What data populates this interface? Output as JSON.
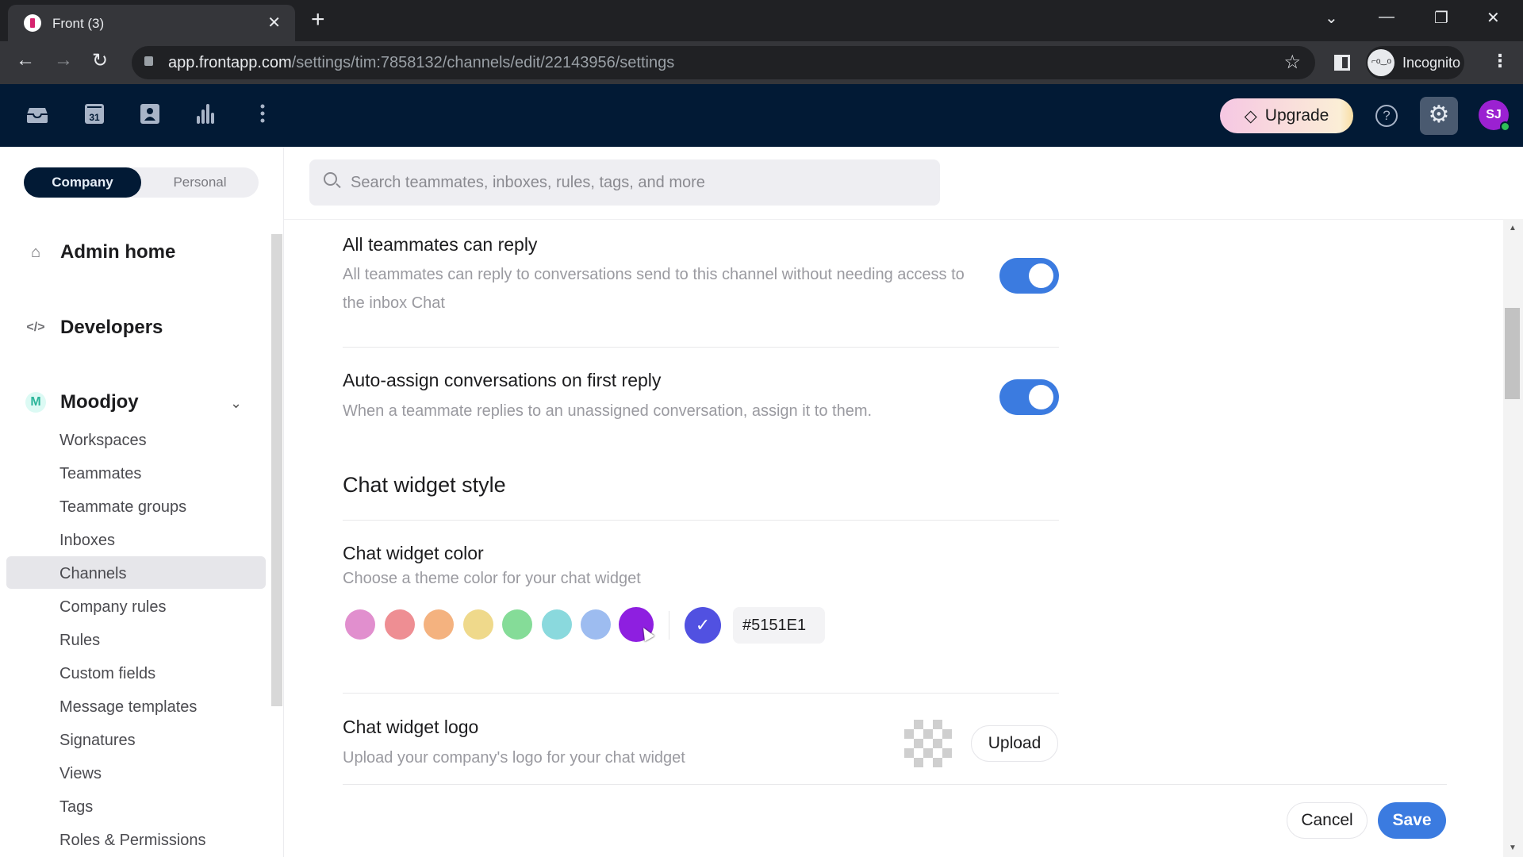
{
  "browser": {
    "tab_title": "Front (3)",
    "url_host": "app.frontapp.com",
    "url_path": "/settings/tim:7858132/channels/edit/22143956/settings",
    "profile_label": "Incognito"
  },
  "appbar": {
    "icons": [
      "inbox-icon",
      "calendar-icon",
      "contacts-icon",
      "analytics-icon",
      "more-icon"
    ],
    "calendar_day": "31",
    "upgrade_label": "Upgrade",
    "help_glyph": "?",
    "avatar_initials": "SJ",
    "avatar_color": "#9b21d1",
    "status": "online"
  },
  "sidebar": {
    "scope_tabs": [
      {
        "label": "Company",
        "active": true
      },
      {
        "label": "Personal",
        "active": false
      }
    ],
    "admin_home": "Admin home",
    "developers": "Developers",
    "workspace": {
      "badge": "M",
      "name": "Moodjoy",
      "expanded": true
    },
    "items": [
      {
        "label": "Workspaces"
      },
      {
        "label": "Teammates"
      },
      {
        "label": "Teammate groups"
      },
      {
        "label": "Inboxes"
      },
      {
        "label": "Channels",
        "active": true
      },
      {
        "label": "Company rules"
      },
      {
        "label": "Rules"
      },
      {
        "label": "Custom fields"
      },
      {
        "label": "Message templates"
      },
      {
        "label": "Signatures"
      },
      {
        "label": "Views"
      },
      {
        "label": "Tags"
      },
      {
        "label": "Roles & Permissions"
      }
    ]
  },
  "search": {
    "placeholder": "Search teammates, inboxes, rules, tags, and more"
  },
  "settings": {
    "all_teammates_reply": {
      "title": "All teammates can reply",
      "description": "All teammates can reply to conversations send to this channel without needing access to the inbox Chat",
      "enabled": true
    },
    "auto_assign": {
      "title": "Auto-assign conversations on first reply",
      "description": "When a teammate replies to an unassigned conversation, assign it to them.",
      "enabled": true
    },
    "chat_widget_style": {
      "heading": "Chat widget style",
      "color": {
        "title": "Chat widget color",
        "description": "Choose a theme color for your chat widget",
        "swatches": [
          "#e18fce",
          "#ee8e93",
          "#f4b27f",
          "#efd98b",
          "#85dc98",
          "#8ad9dd",
          "#9dbcf0",
          "#8e1fe0"
        ],
        "selected_hex": "#5151E1",
        "selected_color": "#5151e1"
      },
      "logo": {
        "title": "Chat widget logo",
        "description": "Upload your company's logo for your chat widget",
        "upload_label": "Upload"
      }
    }
  },
  "footer": {
    "cancel_label": "Cancel",
    "save_label": "Save"
  },
  "accent_color": "#3b7be0"
}
